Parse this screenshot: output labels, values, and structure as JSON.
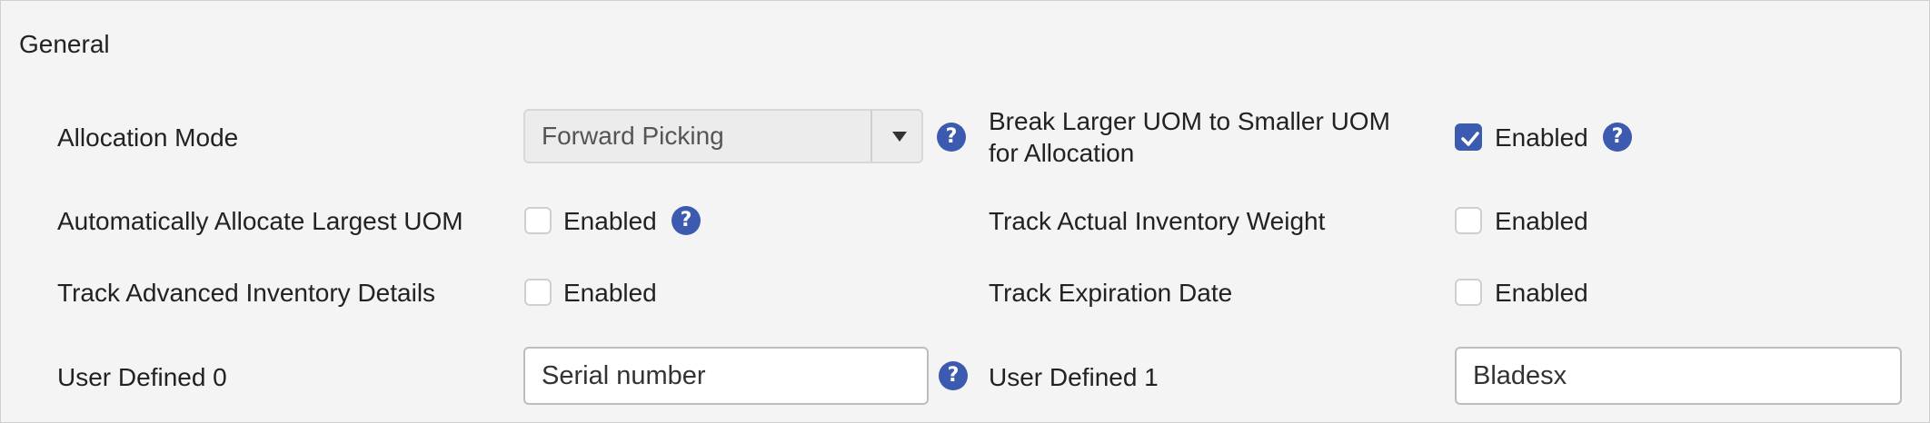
{
  "section": {
    "title": "General"
  },
  "fields": {
    "allocation_mode": {
      "label": "Allocation Mode",
      "value": "Forward Picking"
    },
    "break_larger_uom": {
      "label_line1": "Break Larger UOM to Smaller UOM",
      "label_line2": "for Allocation",
      "checked": true,
      "option_label": "Enabled"
    },
    "auto_allocate_largest": {
      "label": "Automatically Allocate Largest UOM",
      "checked": false,
      "option_label": "Enabled"
    },
    "track_actual_weight": {
      "label": "Track Actual Inventory Weight",
      "checked": false,
      "option_label": "Enabled"
    },
    "track_advanced_details": {
      "label": "Track Advanced Inventory Details",
      "checked": false,
      "option_label": "Enabled"
    },
    "track_expiration_date": {
      "label": "Track Expiration Date",
      "checked": false,
      "option_label": "Enabled"
    },
    "user_defined_0": {
      "label": "User Defined 0",
      "value": "Serial number"
    },
    "user_defined_1": {
      "label": "User Defined 1",
      "value": "Bladesx"
    }
  },
  "icons": {
    "help": "question-mark",
    "checkmark": "check",
    "dropdown": "caret-down"
  },
  "colors": {
    "accent": "#3b5ab0",
    "background": "#f4f4f4"
  },
  "help_glyph": "?"
}
